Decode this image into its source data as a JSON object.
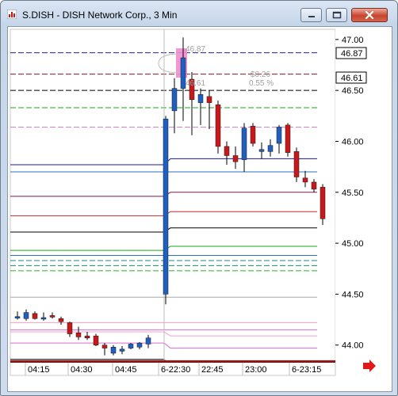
{
  "window": {
    "title": "S.DISH - DISH Network Corp., 3 Min",
    "icon": "chart-app-icon",
    "controls": [
      "minimize-icon",
      "maximize-icon",
      "close-icon"
    ]
  },
  "chart": {
    "price_axis_labels": [
      "47.00",
      "46.50",
      "46.00",
      "45.50",
      "45.00",
      "44.50",
      "44.00"
    ],
    "price_marker_high": "46.87",
    "price_marker_last": "46.61",
    "overlay_high": "46.87",
    "overlay_last": "46.61",
    "overlay_change": "$0.26",
    "overlay_change_pct": "0.55 %",
    "time_labels": [
      "04:15",
      "04:30",
      "04:45",
      "6-22:30",
      "22:45",
      "23:00",
      "6-23:15"
    ],
    "scroll_arrow": "right-arrow-icon",
    "colors": {
      "up_candle": "#1f5fc0",
      "down_candle": "#c8181a",
      "marker_pink": "#f28ccf"
    }
  },
  "chart_data": {
    "type": "candlestick",
    "title": "S.DISH - DISH Network Corp., 3 Min",
    "ylim": [
      43.85,
      47.1
    ],
    "yticks": [
      47.0,
      46.5,
      46.0,
      45.5,
      45.0,
      44.5,
      44.0
    ],
    "x_labels": [
      "04:15",
      "04:30",
      "04:45",
      "6-22:30",
      "22:45",
      "23:00",
      "6-23:15"
    ],
    "candles": [
      {
        "o": 44.28,
        "h": 44.33,
        "l": 44.25,
        "c": 44.28
      },
      {
        "o": 44.26,
        "h": 44.35,
        "l": 44.24,
        "c": 44.32
      },
      {
        "o": 44.31,
        "h": 44.33,
        "l": 44.25,
        "c": 44.26
      },
      {
        "o": 44.27,
        "h": 44.32,
        "l": 44.24,
        "c": 44.27
      },
      {
        "o": 44.29,
        "h": 44.32,
        "l": 44.26,
        "c": 44.28
      },
      {
        "o": 44.26,
        "h": 44.28,
        "l": 44.2,
        "c": 44.23
      },
      {
        "o": 44.22,
        "h": 44.23,
        "l": 44.08,
        "c": 44.11
      },
      {
        "o": 44.12,
        "h": 44.18,
        "l": 44.05,
        "c": 44.08
      },
      {
        "o": 44.09,
        "h": 44.13,
        "l": 44.05,
        "c": 44.07
      },
      {
        "o": 44.09,
        "h": 44.11,
        "l": 43.99,
        "c": 44.0
      },
      {
        "o": 44.0,
        "h": 44.02,
        "l": 43.9,
        "c": 43.97
      },
      {
        "o": 43.92,
        "h": 44.0,
        "l": 43.9,
        "c": 43.98
      },
      {
        "o": 43.94,
        "h": 43.99,
        "l": 43.91,
        "c": 43.96
      },
      {
        "o": 43.97,
        "h": 44.02,
        "l": 43.96,
        "c": 44.01
      },
      {
        "o": 43.98,
        "h": 44.03,
        "l": 43.96,
        "c": 44.02
      },
      {
        "o": 44.01,
        "h": 44.1,
        "l": 43.97,
        "c": 44.07
      },
      {
        "o": 44.5,
        "h": 46.25,
        "l": 44.4,
        "c": 46.22
      },
      {
        "o": 46.3,
        "h": 46.62,
        "l": 46.08,
        "c": 46.52
      },
      {
        "o": 46.52,
        "h": 47.02,
        "l": 46.2,
        "c": 46.82
      },
      {
        "o": 46.61,
        "h": 46.68,
        "l": 46.06,
        "c": 46.41
      },
      {
        "o": 46.38,
        "h": 46.52,
        "l": 46.16,
        "c": 46.46
      },
      {
        "o": 46.44,
        "h": 46.5,
        "l": 46.12,
        "c": 46.38
      },
      {
        "o": 46.36,
        "h": 46.4,
        "l": 45.88,
        "c": 45.95
      },
      {
        "o": 45.95,
        "h": 46.0,
        "l": 45.77,
        "c": 45.86
      },
      {
        "o": 45.86,
        "h": 45.95,
        "l": 45.73,
        "c": 45.8
      },
      {
        "o": 45.82,
        "h": 46.18,
        "l": 45.7,
        "c": 46.13
      },
      {
        "o": 46.15,
        "h": 46.18,
        "l": 45.95,
        "c": 45.98
      },
      {
        "o": 45.9,
        "h": 45.99,
        "l": 45.83,
        "c": 45.92
      },
      {
        "o": 45.9,
        "h": 46.02,
        "l": 45.85,
        "c": 45.96
      },
      {
        "o": 45.98,
        "h": 46.16,
        "l": 45.88,
        "c": 46.14
      },
      {
        "o": 46.16,
        "h": 46.18,
        "l": 45.85,
        "c": 45.89
      },
      {
        "o": 45.9,
        "h": 45.94,
        "l": 45.6,
        "c": 45.65
      },
      {
        "o": 45.64,
        "h": 45.71,
        "l": 45.55,
        "c": 45.6
      },
      {
        "o": 45.6,
        "h": 45.63,
        "l": 45.5,
        "c": 45.53
      },
      {
        "o": 45.55,
        "h": 45.58,
        "l": 45.18,
        "c": 45.24
      }
    ],
    "levels": [
      {
        "price": 46.87,
        "color": "#2b1e8a",
        "style": "dashed",
        "span": "full"
      },
      {
        "price": 46.66,
        "color": "#8a1a2a",
        "style": "dashed",
        "span": "full"
      },
      {
        "price": 46.5,
        "color": "#000000",
        "style": "dashed",
        "span": "full"
      },
      {
        "price": 46.33,
        "color": "#1aaa1a",
        "style": "dashed",
        "span": "full"
      },
      {
        "price": 46.14,
        "color": "#d97ed4",
        "style": "dashed",
        "span": "full"
      },
      {
        "price": 45.83,
        "from": 45.77,
        "color": "#1a1aa0",
        "style": "solid",
        "span": "right"
      },
      {
        "price": 45.7,
        "color": "#2a72c8",
        "style": "solid",
        "span": "full"
      },
      {
        "price": 45.5,
        "from": 45.46,
        "color": "#7a1a5a",
        "style": "solid",
        "span": "right"
      },
      {
        "price": 45.31,
        "from": 45.27,
        "color": "#c82a2a",
        "style": "solid",
        "span": "right"
      },
      {
        "price": 45.15,
        "from": 45.11,
        "color": "#000000",
        "style": "solid",
        "span": "right"
      },
      {
        "price": 44.97,
        "from": 44.93,
        "color": "#1aaa1a",
        "style": "solid",
        "span": "right"
      },
      {
        "price": 44.88,
        "color": "#2a72c8",
        "style": "solid",
        "span": "full"
      },
      {
        "price": 44.83,
        "color": "#1a8a8a",
        "style": "dashed",
        "span": "full"
      },
      {
        "price": 44.78,
        "color": "#1a8a6a",
        "style": "dashed",
        "span": "full"
      },
      {
        "price": 44.73,
        "color": "#2ab02a",
        "style": "dashed",
        "span": "full"
      },
      {
        "price": 44.47,
        "color": "#aaaaaa",
        "style": "solid",
        "span": "right"
      },
      {
        "price": 44.22,
        "color": "#f0a0c0",
        "style": "solid",
        "span": "full"
      },
      {
        "price": 44.15,
        "color": "#d86ad0",
        "style": "solid",
        "span": "full"
      },
      {
        "price": 44.09,
        "from": 44.13,
        "color": "#f0a0c0",
        "style": "solid",
        "span": "full"
      },
      {
        "price": 43.97,
        "from": 44.02,
        "color": "#d86ad0",
        "style": "solid",
        "span": "full"
      },
      {
        "price": 43.81,
        "from": 43.86,
        "color": "#000000",
        "style": "solid",
        "span": "full"
      }
    ]
  }
}
